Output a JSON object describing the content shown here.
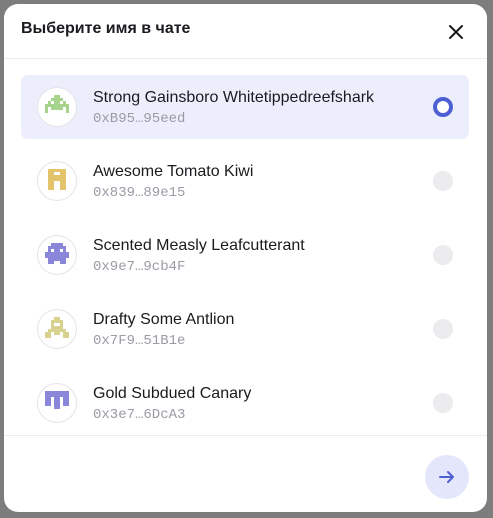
{
  "dialog": {
    "title": "Выберите имя в чате",
    "close_icon": "close-icon",
    "next_icon": "arrow-right-icon"
  },
  "colors": {
    "accent": "#4e5fd4",
    "selected_row": "#eceefc",
    "address_text": "#9b9ba5"
  },
  "options": [
    {
      "name": "Strong Gainsboro Whitetippedreefshark",
      "address": "0xB95…95eed",
      "selected": true,
      "avatar_icon": "pixel-invader-avatar-icon",
      "avatar_color": "#a8d38d"
    },
    {
      "name": "Awesome Tomato Kiwi",
      "address": "0x839…89e15",
      "selected": false,
      "avatar_icon": "pixel-m-avatar-icon",
      "avatar_color": "#e3c46b"
    },
    {
      "name": "Scented Measly Leafcutterant",
      "address": "0x9e7…9cb4F",
      "selected": false,
      "avatar_icon": "pixel-ghost-avatar-icon",
      "avatar_color": "#8a86d9"
    },
    {
      "name": "Drafty Some Antlion",
      "address": "0x7F9…51B1e",
      "selected": false,
      "avatar_icon": "pixel-face-avatar-icon",
      "avatar_color": "#d8d28e"
    },
    {
      "name": "Gold Subdued Canary",
      "address": "0x3e7…6DcA3",
      "selected": false,
      "avatar_icon": "pixel-comb-avatar-icon",
      "avatar_color": "#8a86d9"
    }
  ]
}
